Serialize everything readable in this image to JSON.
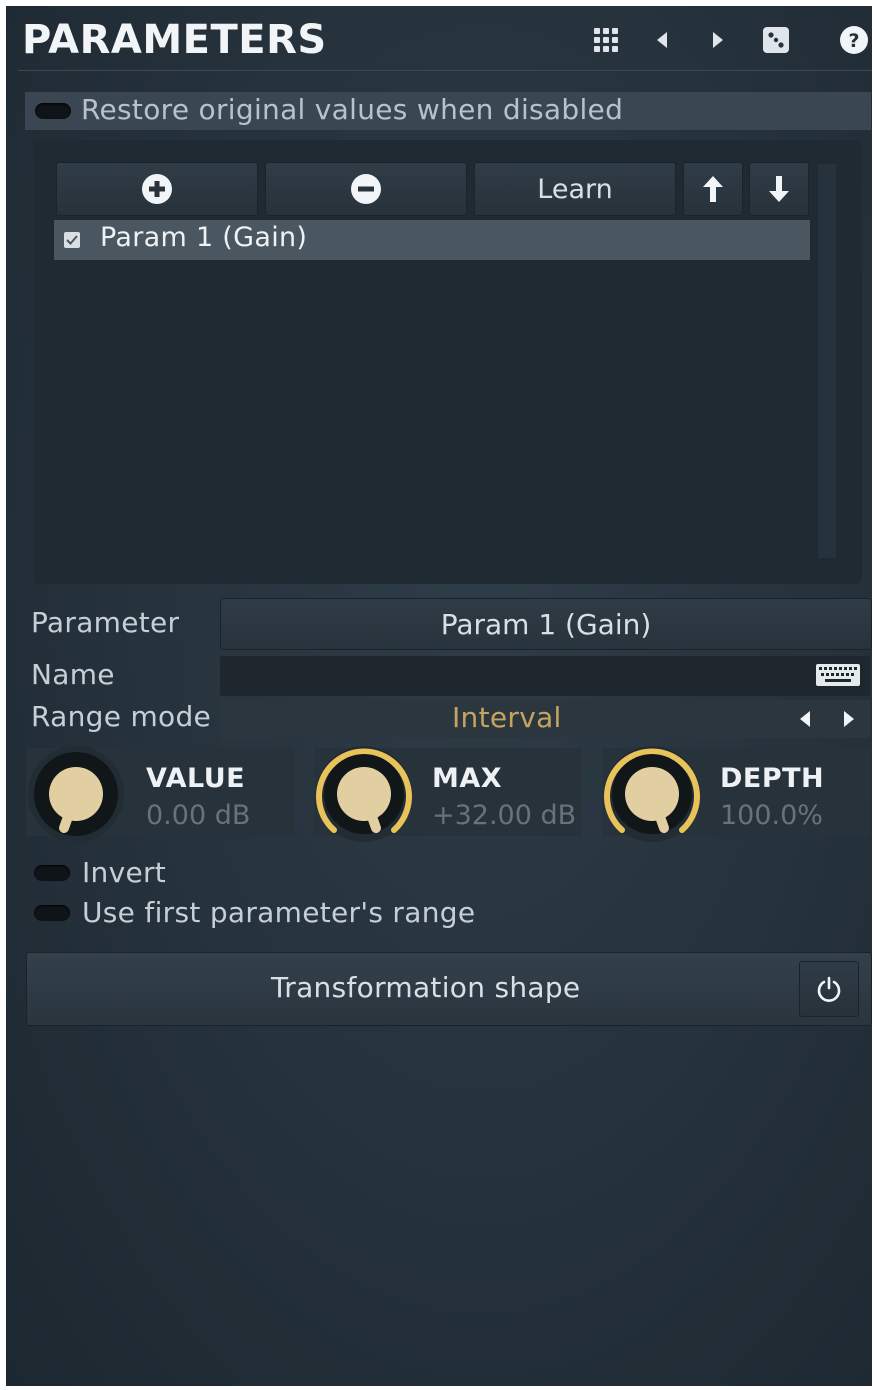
{
  "header": {
    "title": "PARAMETERS",
    "icons": [
      "grid-icon",
      "prev-arrow-icon",
      "next-arrow-icon",
      "dice-icon",
      "help-icon"
    ]
  },
  "restore_toggle": {
    "label": "Restore original values when disabled",
    "on": false
  },
  "list_toolbar": {
    "learn_label": "Learn"
  },
  "list": {
    "items": [
      {
        "label": "Param 1 (Gain)",
        "checked": true
      }
    ]
  },
  "form": {
    "parameter_label": "Parameter",
    "parameter_value": "Param 1 (Gain)",
    "name_label": "Name",
    "name_value": "",
    "range_mode_label": "Range mode",
    "range_mode_value": "Interval"
  },
  "knobs": {
    "value": {
      "title": "VALUE",
      "value": "0.00 dB"
    },
    "max": {
      "title": "MAX",
      "value": "+32.00 dB"
    },
    "depth": {
      "title": "DEPTH",
      "value": "100.0%"
    }
  },
  "toggles": {
    "invert": "Invert",
    "use_first_range": "Use first parameter's range"
  },
  "transformation": {
    "label": "Transformation shape"
  },
  "colors": {
    "accent_gold": "#e8c35a",
    "knob_cap": "#e2cfa1",
    "panel_bg": "#25313b"
  }
}
